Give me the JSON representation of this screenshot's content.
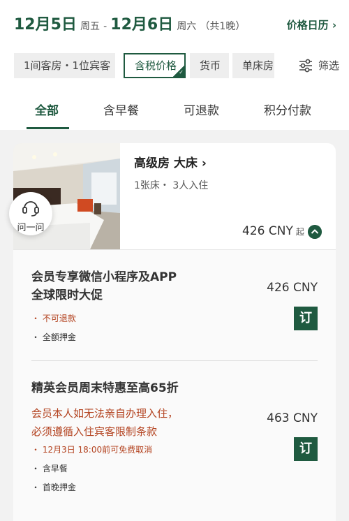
{
  "header": {
    "checkin_date": "12月5日",
    "checkin_weekday": "周五",
    "separator": "-",
    "checkout_date": "12月6日",
    "checkout_weekday": "周六",
    "nights": "（共1晚）",
    "price_calendar": "价格日历",
    "calendar_chevron": "›"
  },
  "chips": [
    {
      "label": "1间客房・1位宾客"
    },
    {
      "label": "含税价格",
      "selected": true
    },
    {
      "label": "货币"
    },
    {
      "label": "单床房"
    }
  ],
  "filter": {
    "label": "筛选",
    "icon": "sliders-icon"
  },
  "tabs": [
    {
      "label": "全部",
      "active": true
    },
    {
      "label": "含早餐"
    },
    {
      "label": "可退款"
    },
    {
      "label": "积分付款"
    }
  ],
  "room": {
    "name": "高级房 大床",
    "name_chevron": "›",
    "details": "1张床・ 3人入住",
    "price": "426 CNY",
    "price_suffix": "起",
    "expand_icon": "chevron-up-icon"
  },
  "rates": [
    {
      "name_line1": "会员专享微信小程序及APP",
      "name_line2": "全球限时大促",
      "price": "426 CNY",
      "book_label": "订",
      "notes_red": [
        "・ 不可退款"
      ],
      "notes": [
        "・ 全额押金"
      ]
    },
    {
      "name_line1": "精英会员周末特惠至高65折",
      "warning_line1": "会员本人如无法亲自办理入住，",
      "warning_line2": "必须遵循入住宾客限制条款",
      "price": "463 CNY",
      "book_label": "订",
      "notes_red": [
        "・ 12月3日 18:00前可免费取消"
      ],
      "notes": [
        "・ 含早餐",
        "・ 首晚押金"
      ]
    }
  ],
  "help": {
    "label": "问一问",
    "icon": "headset-icon"
  },
  "colors": {
    "brand_green": "#1f5a40",
    "warning_red": "#b3421f"
  }
}
